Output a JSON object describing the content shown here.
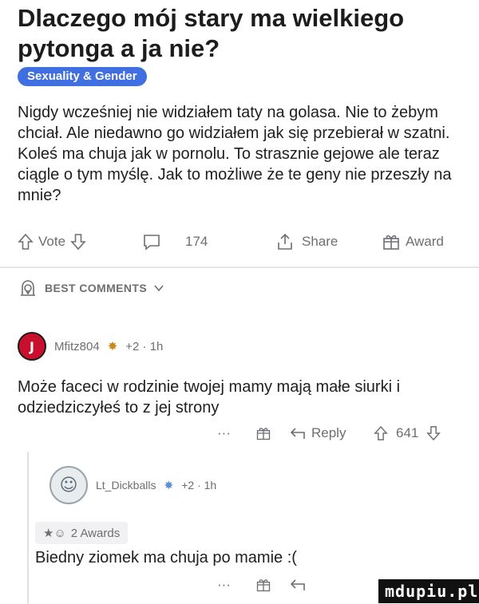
{
  "post": {
    "title": "Dlaczego mój stary ma wielkiego pytonga a ja nie?",
    "flair": "Sexuality & Gender",
    "body": "Nigdy wcześniej nie widziałem taty na golasa. Nie to żebym chciał. Ale niedawno go widziałem jak się przebierał w szatni. Koleś ma chuja jak w pornolu. To strasznie gejowe ale teraz ciągle o tym myślę. Jak to możliwe że te geny nie przeszły na mnie?"
  },
  "actions": {
    "vote_label": "Vote",
    "comments_count": "174",
    "share_label": "Share",
    "award_label": "Award"
  },
  "sort": {
    "label": "BEST COMMENTS"
  },
  "comments": [
    {
      "user": "Mfitz804",
      "meta": "+2 · 1h",
      "text": "Może faceci w rodzinie twojej mamy mają małe siurki i odziedziczyłeś to z jej strony",
      "more": "···",
      "reply_label": "Reply",
      "votes": "641"
    },
    {
      "user": "Lt_Dickballs",
      "meta": "+2 · 1h",
      "awards": "2 Awards",
      "text": "Biedny ziomek ma chuja po mamie :(",
      "more": "···"
    }
  ],
  "watermark": "mdupiu.pl",
  "colors": {
    "flair_bg": "#3f6fe0",
    "meta_gray": "#6e6e73",
    "avatar_red": "#c8102e"
  },
  "icons": [
    "upvote-icon",
    "downvote-icon",
    "comment-icon",
    "share-icon",
    "award-icon",
    "best-sort-icon",
    "chevron-down-icon",
    "reply-icon"
  ]
}
